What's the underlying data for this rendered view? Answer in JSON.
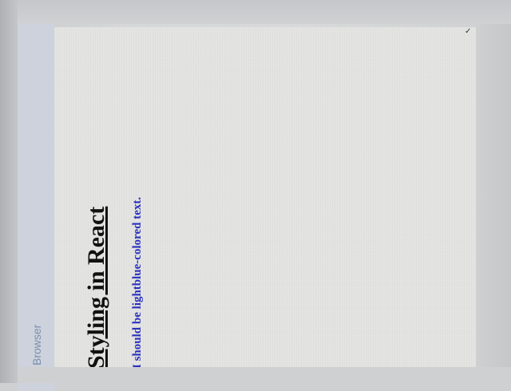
{
  "browser": {
    "sidebar_label": "Browser"
  },
  "content": {
    "heading": "Styling in React",
    "subtext": "I should be lightblue-colored text."
  },
  "colors": {
    "heading": "#111111",
    "subtext": "#2a2fc0",
    "sidebar_label": "#7b8fae",
    "panel_background": "#e3e3e1"
  }
}
